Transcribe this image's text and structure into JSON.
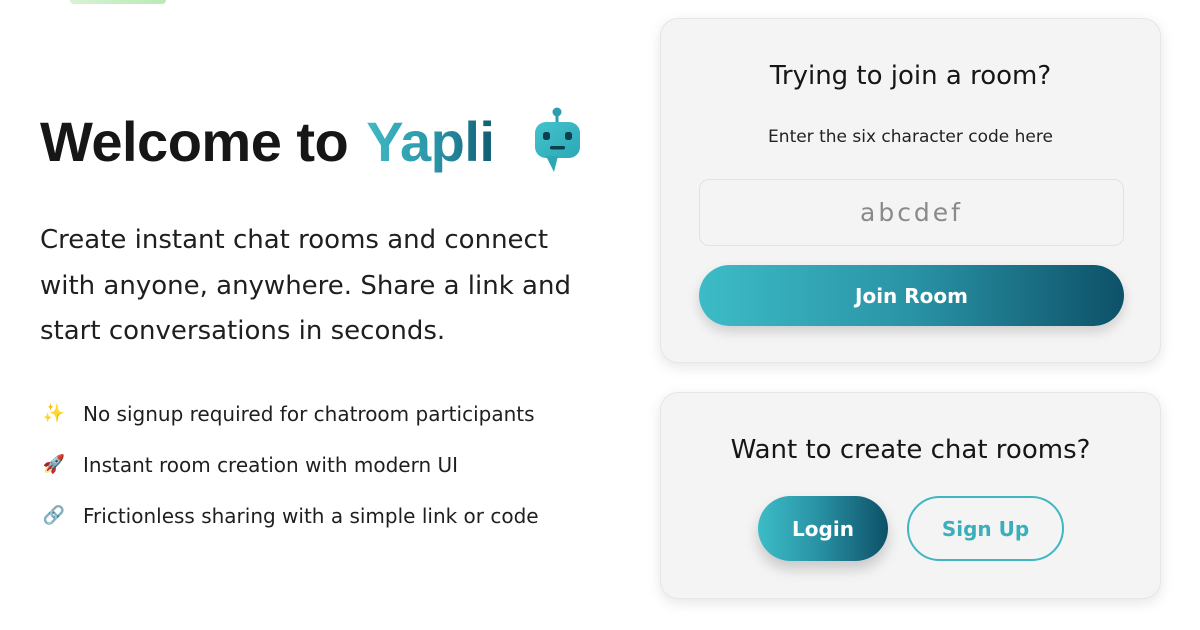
{
  "hero": {
    "title_prefix": "Welcome to",
    "brand": "Yapli",
    "tagline": "Create instant chat rooms and connect with anyone, anywhere. Share a link and start conversations in seconds."
  },
  "features": [
    {
      "icon": "✨",
      "icon_name": "sparkles-icon",
      "text": "No signup required for chatroom participants"
    },
    {
      "icon": "🚀",
      "icon_name": "rocket-icon",
      "text": "Instant room creation with modern UI"
    },
    {
      "icon": "🔗",
      "icon_name": "link-icon",
      "text": "Frictionless sharing with a simple link or code"
    }
  ],
  "join_card": {
    "title": "Trying to join a room?",
    "subtitle": "Enter the six character code here",
    "input_placeholder": "abcdef",
    "input_value": "",
    "button_label": "Join Room"
  },
  "create_card": {
    "title": "Want to create chat rooms?",
    "login_label": "Login",
    "signup_label": "Sign Up"
  },
  "colors": {
    "brand_start": "#3fbac4",
    "brand_end": "#0f5c72",
    "card_bg": "#f4f4f4",
    "text": "#161616"
  }
}
